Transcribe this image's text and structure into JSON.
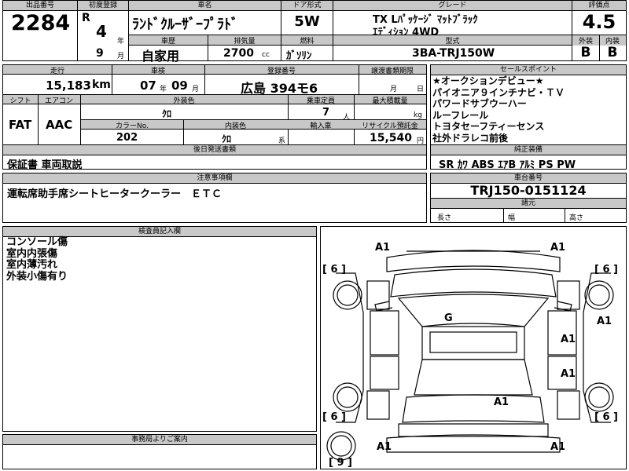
{
  "header": {
    "lot_label": "出品番号",
    "lot": "2284",
    "first_reg_label": "初度登録",
    "era": "R",
    "year": "4",
    "year_unit": "年",
    "month": "9",
    "month_unit": "月",
    "car_name_label": "車名",
    "car_name": "ﾗﾝﾄﾞｸﾙｰｻﾞｰﾌﾟﾗﾄﾞ",
    "door_label": "ドア形式",
    "door": "5W",
    "grade_label": "グレード",
    "grade_line1": "TX Lﾊﾟｯｹｰｼﾞ ﾏｯﾄﾌﾞﾗｯｸ",
    "grade_line2": "ｴﾃﾞｨｼｮﾝ 4WD",
    "score_label": "評価点",
    "score": "4.5",
    "ext_label": "外装",
    "ext": "B",
    "int_label": "内装",
    "int": "B",
    "history_label": "車歴",
    "history": "自家用",
    "disp_label": "排気量",
    "disp": "2700",
    "disp_unit": "cc",
    "fuel_label": "燃料",
    "fuel": "ｶﾞｿﾘﾝ",
    "model_label": "型式",
    "model": "3BA-TRJ150W"
  },
  "row2": {
    "mileage_label": "走行",
    "mileage": "15,183",
    "mileage_unit": "km",
    "inspection_label": "車検",
    "insp_year": "07",
    "insp_year_unit": "年",
    "insp_month": "09",
    "insp_month_unit": "月",
    "reg_no_label": "登録番号",
    "reg_no": "広島 394モ6",
    "transfer_label": "譲渡書類期限",
    "transfer_month_unit": "月",
    "transfer_day_unit": "日",
    "shift_label": "シフト",
    "shift": "FAT",
    "ac_label": "エアコン",
    "ac": "AAC",
    "ext_color_label": "外装色",
    "ext_color": "ｸﾛ",
    "capacity_label": "乗車定員",
    "capacity": "7",
    "capacity_unit": "人",
    "max_load_label": "最大積載量",
    "max_load_unit": "kg",
    "color_no_label": "カラーNo.",
    "color_no": "202",
    "int_color_label": "内装色",
    "int_color": "ｸﾛ",
    "int_color_unit": "系",
    "import_label": "輸入車",
    "recycle_label": "リサイクル預託金",
    "recycle": "15,540",
    "recycle_unit": "円",
    "docs_label": "後日発送書類",
    "docs": "保証書 車両取説"
  },
  "selling": {
    "label": "セールスポイント",
    "points": [
      "★オークションデビュー★",
      "パイオニア９インチナビ・ＴＶ",
      "パワードサブウーハー",
      "ルーフレール",
      "トヨタセーフティーセンス",
      "社外ドラレコ前後"
    ]
  },
  "equipment": {
    "label": "純正装備",
    "items": [
      "SR",
      "ｶﾜ",
      "ABS",
      "ｴｱB",
      "ｱﾙﾐ",
      "PS",
      "PW"
    ]
  },
  "notes": {
    "label": "注意事項欄",
    "text": "運転席助手席シートヒータークーラー　ＥＴＣ"
  },
  "chassis": {
    "label": "車台番号",
    "number": "TRJ150-0151124",
    "dims_label": "諸元",
    "length_label": "長さ",
    "width_label": "幅",
    "height_label": "高さ"
  },
  "inspector": {
    "label": "検査員記入欄",
    "lines": [
      "コンソール傷",
      "室内内張傷",
      "室内薄汚れ",
      "外装小傷有り"
    ]
  },
  "office": {
    "label": "事務局よりご案内"
  },
  "diagram": {
    "marks": {
      "a1_front_left": "A1",
      "a1_front_right": "A1",
      "g_roof": "G",
      "a1_right_side": "A1",
      "a1_right_door1": "A1",
      "a1_right_door2": "A1",
      "a1_rear": "A1",
      "a1_rear_left": "A1",
      "a1_rear_right": "A1"
    },
    "tires": {
      "front_left": "6",
      "front_right": "6",
      "rear_left": "6",
      "rear_right": "6",
      "spare": "9"
    }
  }
}
